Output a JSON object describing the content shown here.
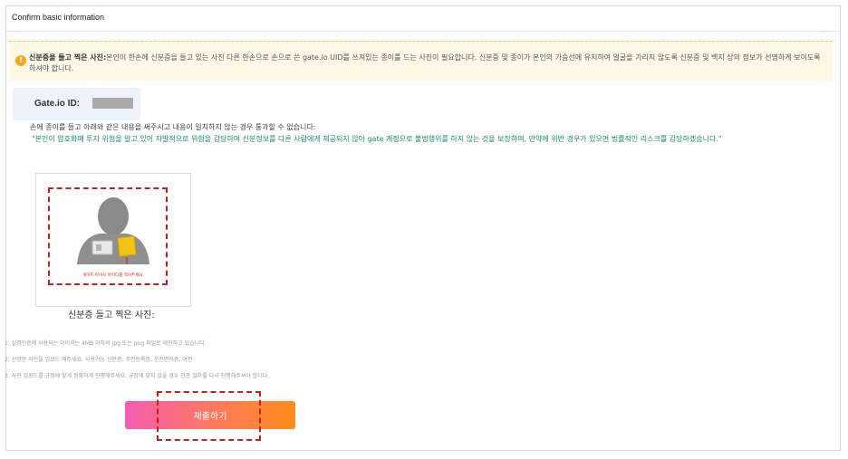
{
  "header": {
    "title": "Confirm basic information"
  },
  "notice": {
    "icon": "warning-icon",
    "bold": "신분증을 들고 찍은 사진:",
    "text": "본인이 한손에 신분증을 들고 있는 사진 다른 한손으로 손으로 쓴 gate.io UID를 쓰져있는 종이를 드는 사진이 필요합니다. 신분증 및 종이가 본인의 가슴선에 유지하여 얼굴을 가리지 않도록 신분증 및 백지 상의 정보가 선명하게 보이도록 하셔야 합니다."
  },
  "uid": {
    "label": "Gate.io ID:"
  },
  "instruction": "손에 종이를 들고 아래와 같은 내용을 써주시고 내용이 일치하지 않는 경우 통과할 수 없습니다:",
  "quote": "\"본인이 암호화폐 투자 위험을 알고 있어 자발적으로 위험을 감당하여 신분정보를 다른 사람에게 제공되지 않아 gate 계정으로 불법행위를 하지 않는 것을 보장하며, 만약에 위반 경우가 있으면 법률적인 리스크를 감당하겠습니다.\"",
  "example": {
    "note": "게이트 아이오 아이디를 적어주세요.",
    "caption": "신분증 들고 찍은 사진:"
  },
  "rules": [
    "1. 실명인증에 사용되는 이미지는 4MB 이하의 jpg 또는 png 파일로 제한하고 있습니다.",
    "2. 선명한 사진을 업로드 해주세요. 사용가능 신분증: 주민등록증, 운전면허증, 여권",
    "3. 사진 업로드를 규정에 맞게 정확하게 진행해주세요. 규정에 맞지 않을 경우 인증 절차를 다시 진행해주셔야 합니다."
  ],
  "submit": {
    "label": "제출하기"
  },
  "colors": {
    "accent": "#ff8c1a",
    "quote": "#1b8a6b",
    "notice_bg": "#fdf7e6",
    "highlight": "#d11a1a"
  }
}
